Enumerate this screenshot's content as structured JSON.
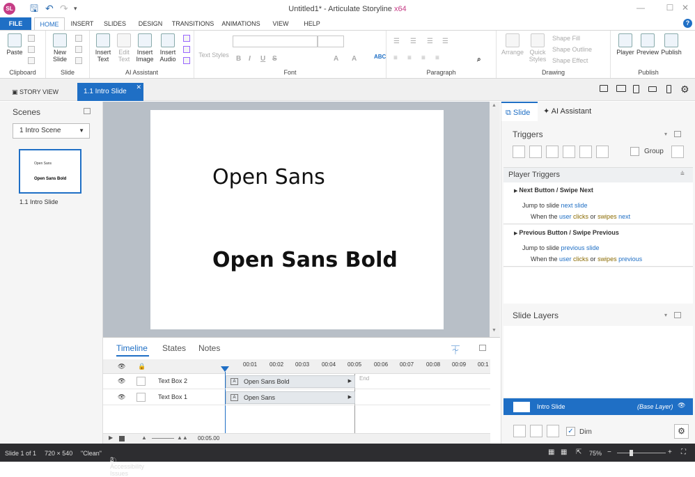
{
  "app": {
    "title": "Untitled1* -  Articulate Storyline",
    "arch": "x64",
    "logo": "SL"
  },
  "menu_tabs": [
    "FILE",
    "HOME",
    "INSERT",
    "SLIDES",
    "DESIGN",
    "TRANSITIONS",
    "ANIMATIONS",
    "VIEW",
    "HELP"
  ],
  "ribbon": {
    "groups": {
      "clipboard": "Clipboard",
      "slide": "Slide",
      "ai": "AI Assistant",
      "font": "Font",
      "paragraph": "Paragraph",
      "drawing": "Drawing",
      "publish": "Publish"
    },
    "buttons": {
      "paste": "Paste",
      "new_slide": "New Slide",
      "insert_text": "Insert Text",
      "edit_text": "Edit Text",
      "insert_image": "Insert Image",
      "insert_audio": "Insert Audio",
      "text_styles": "Text Styles",
      "arrange": "Arrange",
      "quick_styles": "Quick Styles",
      "player": "Player",
      "preview": "Preview",
      "publish": "Publish"
    },
    "drawing_opts": [
      "Shape Fill",
      "Shape Outline",
      "Shape Effect"
    ]
  },
  "doc_tabs": {
    "story_view": "STORY VIEW",
    "slide": "1.1 Intro Slide"
  },
  "left": {
    "scenes_title": "Scenes",
    "scene_select": "1 Intro Scene",
    "thumb_line1": "Open Sans",
    "thumb_line2": "Open Sans Bold",
    "thumb_label": "1.1 Intro Slide"
  },
  "slide": {
    "text1": "Open Sans",
    "text2": "Open Sans Bold"
  },
  "timeline": {
    "tabs": [
      "Timeline",
      "States",
      "Notes"
    ],
    "ticks": [
      "00:01",
      "00:02",
      "00:03",
      "00:04",
      "00:05",
      "00:06",
      "00:07",
      "00:08",
      "00:09",
      "00:1"
    ],
    "end_label": "End",
    "rows": [
      {
        "label": "Text Box 2",
        "bar": "Open Sans Bold"
      },
      {
        "label": "Text Box 1",
        "bar": "Open Sans"
      }
    ],
    "time": "00:05.00"
  },
  "right": {
    "tabs": {
      "slide": "Slide",
      "ai": "AI Assistant"
    },
    "triggers_title": "Triggers",
    "group_label": "Group",
    "player_triggers": "Player Triggers",
    "t1": {
      "title": "Next Button / Swipe Next",
      "l1a": "Jump to slide ",
      "l1b": "next slide",
      "l2a": "When the ",
      "l2b": "user",
      "l2c": " clicks",
      "l2d": " or ",
      "l2e": "swipes",
      "l2f": " next"
    },
    "t2": {
      "title": "Previous Button / Swipe Previous",
      "l1a": "Jump to slide ",
      "l1b": "previous slide",
      "l2a": "When the ",
      "l2b": "user",
      "l2c": " clicks",
      "l2d": " or ",
      "l2e": "swipes",
      "l2f": " previous"
    },
    "layers_title": "Slide Layers",
    "layer_name": "Intro Slide",
    "layer_base": "(Base Layer)",
    "dim_label": "Dim"
  },
  "status": {
    "slide": "Slide 1 of 1",
    "size": "720 × 540",
    "theme": "\"Clean\"",
    "issues": "2 Accessibility Issues",
    "zoom": "75%"
  }
}
